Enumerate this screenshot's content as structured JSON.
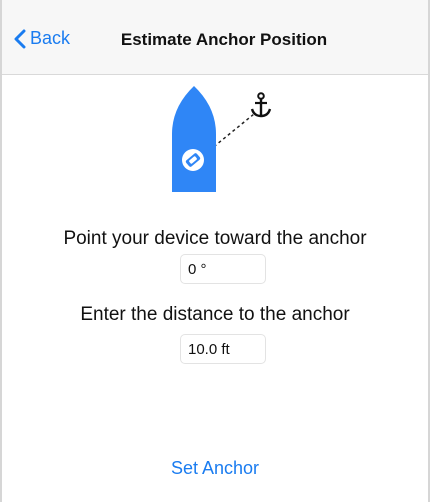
{
  "nav": {
    "back_label": "Back",
    "title": "Estimate Anchor Position"
  },
  "heading_prompt": "Point your device toward the anchor",
  "heading_field": {
    "value": "0 °"
  },
  "distance_prompt": "Enter the distance to the anchor",
  "distance_field": {
    "value": "10.0 ft"
  },
  "set_anchor_label": "Set Anchor",
  "colors": {
    "accent": "#1a7cf0",
    "boat": "#2f86f6",
    "nav_background": "#f7f7f7"
  },
  "icons": {
    "back": "chevron-left-icon",
    "boat": "boat-icon",
    "anchor": "anchor-icon"
  }
}
